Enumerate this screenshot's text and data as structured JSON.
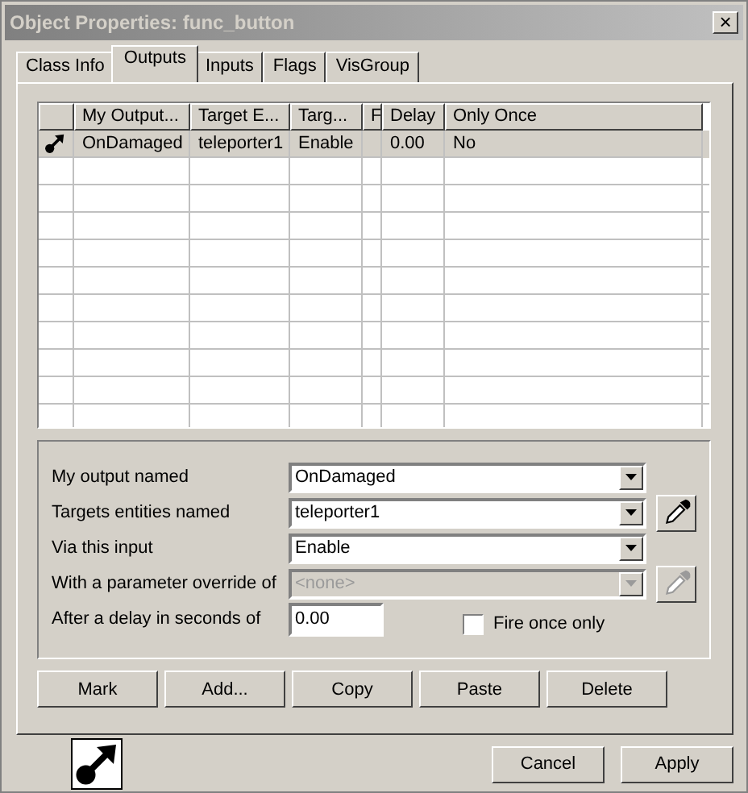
{
  "window": {
    "title": "Object Properties: func_button",
    "close": "×"
  },
  "tabs": [
    {
      "label": "Class Info",
      "selected": false
    },
    {
      "label": "Outputs",
      "selected": true
    },
    {
      "label": "Inputs",
      "selected": false
    },
    {
      "label": "Flags",
      "selected": false
    },
    {
      "label": "VisGroup",
      "selected": false
    }
  ],
  "table": {
    "columns": [
      "My Output...",
      "Target E...",
      "Targ...",
      "F",
      "Delay",
      "Only Once"
    ],
    "rows": [
      {
        "selected": true,
        "cells": [
          "OnDamaged",
          "teleporter1",
          "Enable",
          "",
          "0.00",
          "No"
        ]
      }
    ]
  },
  "form": {
    "fields": [
      {
        "label": "My output named",
        "kind": "combo",
        "value": "OnDamaged",
        "disabled": false
      },
      {
        "label": "Targets entities named",
        "kind": "combo",
        "value": "teleporter1",
        "disabled": false,
        "picker": true
      },
      {
        "label": "Via this input",
        "kind": "combo",
        "value": "Enable",
        "disabled": false
      },
      {
        "label": "With a parameter override of",
        "kind": "combo",
        "value": "<none>",
        "disabled": true,
        "picker": true
      },
      {
        "label": "After a delay in seconds of",
        "kind": "text",
        "value": "0.00",
        "disabled": false
      }
    ],
    "checkbox": {
      "label": "Fire once only",
      "checked": false
    }
  },
  "actions": [
    "Mark",
    "Add...",
    "Copy",
    "Paste",
    "Delete"
  ],
  "buttons": [
    "Cancel",
    "Apply"
  ]
}
